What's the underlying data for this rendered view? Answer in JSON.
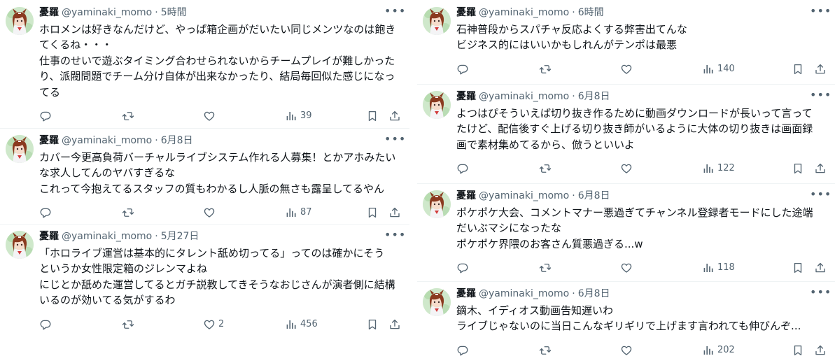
{
  "author": {
    "name": "憂羅",
    "handle": "@yaminaki_momo",
    "separator": "·"
  },
  "icons": {
    "more": "more-horizontal-icon",
    "reply": "reply-bubble-icon",
    "retweet": "retweet-icon",
    "like": "heart-icon",
    "views": "analytics-bars-icon",
    "bookmark": "bookmark-icon",
    "share": "share-upload-icon"
  },
  "colors": {
    "text": "#0f1419",
    "secondary": "#536471",
    "divider": "#eff3f4"
  },
  "left_column": [
    {
      "time": "5時間",
      "lines": [
        "ホロメンは好きなんだけど、やっぱ箱企画がだいたい同じメンツなのは飽き",
        "てくるね・・・",
        "仕事のせいで遊ぶタイミング合わせられないからチームプレイが難しかった",
        "り、派閥問題でチーム分け自体が出来なかったり、結局毎回似た感じになっ",
        "てる"
      ],
      "likes": "",
      "views": "39"
    },
    {
      "time": "6月8日",
      "lines": [
        "カバー今更高負荷バーチャルライブシステム作れる人募集！とかアホみたい",
        "な求人してんのヤバすぎるな",
        "これって今抱えてるスタッフの質もわかるし人脈の無さも露呈してるやん"
      ],
      "likes": "",
      "views": "87"
    },
    {
      "time": "5月27日",
      "lines": [
        "「ホロライブ運営は基本的にタレント舐め切ってる」ってのは確かにそう",
        "というか女性限定箱のジレンマよね",
        "にじとか舐めた運営してるとガチ説教してきそうなおじさんが演者側に結構",
        "いるのが効いてる気がするわ"
      ],
      "likes": "2",
      "views": "456"
    }
  ],
  "right_column": [
    {
      "time": "6時間",
      "lines": [
        "石神普段からスパチャ反応よくする弊害出てんな",
        "ビジネス的にはいいかもしれんがテンポは最悪"
      ],
      "likes": "",
      "views": "140"
    },
    {
      "time": "6月8日",
      "lines": [
        "よつはぴそういえば切り抜き作るために動画ダウンロードが長いって言って",
        "たけど、配信後すぐ上げる切り抜き師がいるように大体の切り抜きは画面録",
        "画で素材集めてるから、倣うといいよ"
      ],
      "likes": "",
      "views": "122"
    },
    {
      "time": "6月8日",
      "lines": [
        "ポケポケ大会、コメントマナー悪過ぎてチャンネル登録者モードにした途端",
        "だいぶマシになったな",
        "ポケポケ界隈のお客さん質悪過ぎる...w"
      ],
      "likes": "",
      "views": "118"
    },
    {
      "time": "6月8日",
      "lines": [
        "鏑木、イディオス動画告知遅いわ",
        "ライブじゃないのに当日こんなギリギリで上げます言われても伸びんぞ..."
      ],
      "likes": "",
      "views": "202"
    }
  ]
}
